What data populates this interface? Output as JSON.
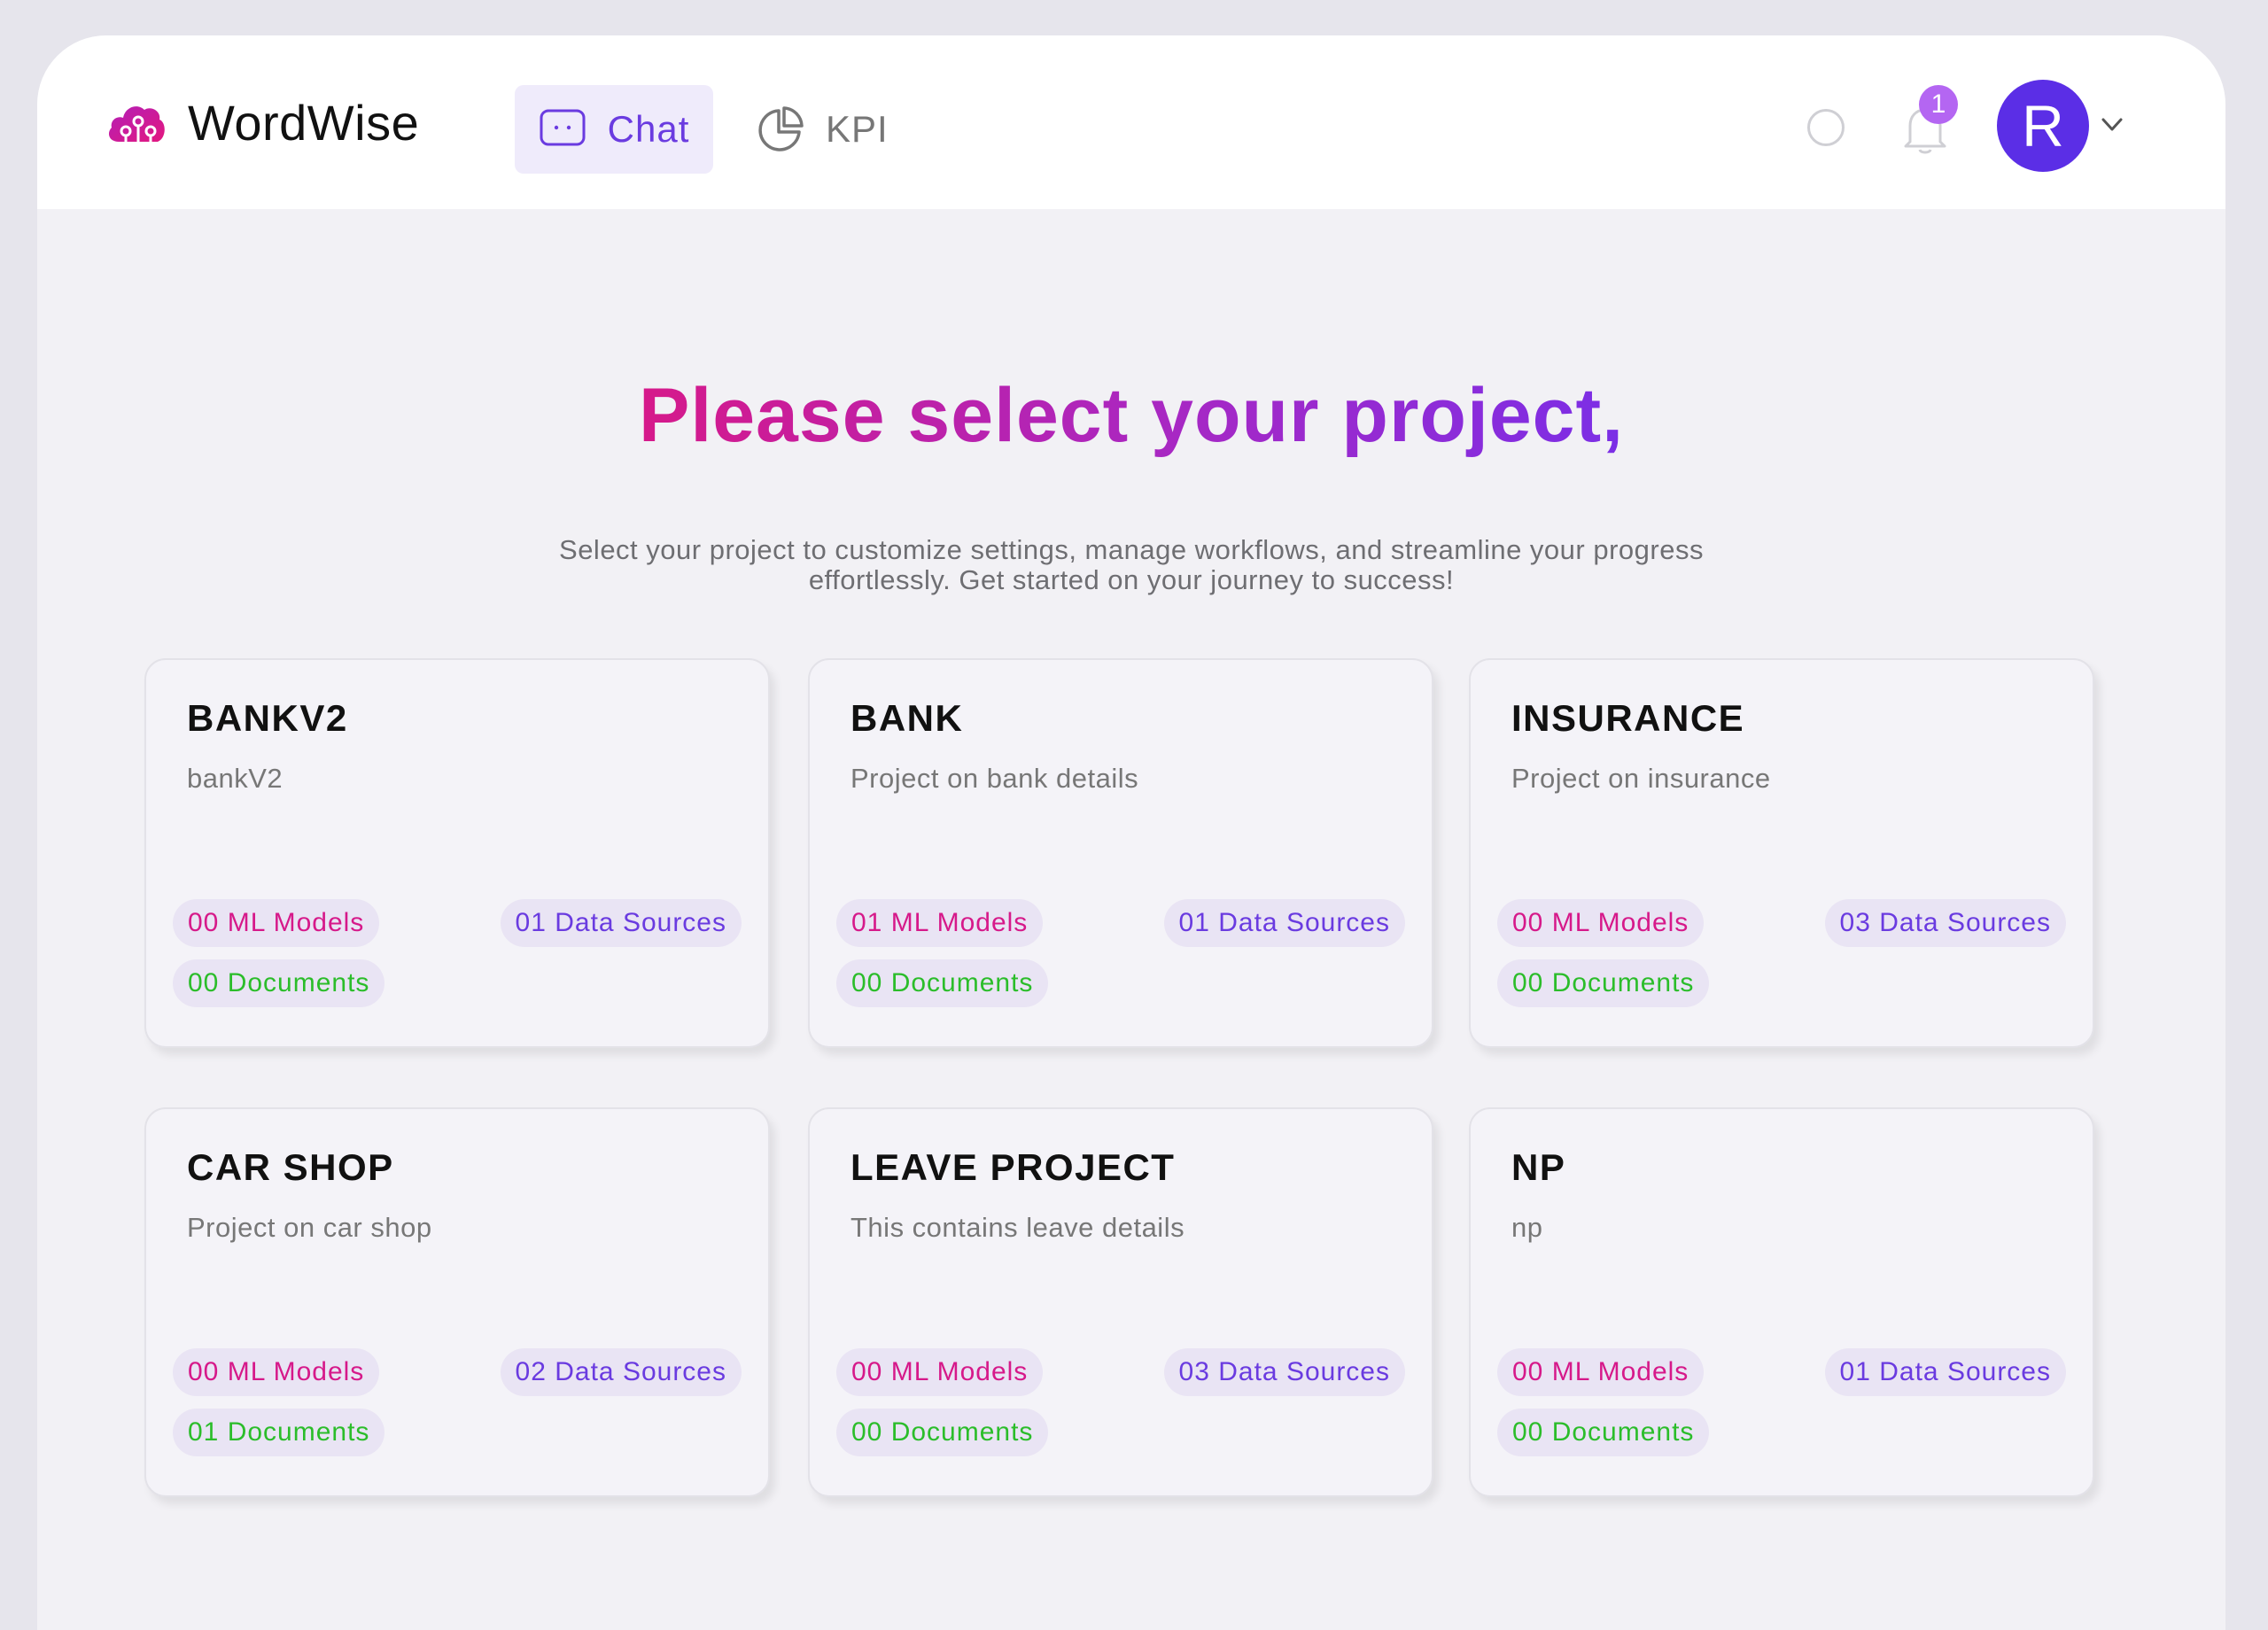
{
  "app": {
    "name": "WordWise"
  },
  "nav": {
    "tabs": [
      {
        "label": "Chat",
        "icon": "chat-bubble-icon",
        "active": true
      },
      {
        "label": "KPI",
        "icon": "pie-chart-icon",
        "active": false
      }
    ]
  },
  "header": {
    "notification_count": "1",
    "avatar_initial": "R"
  },
  "main": {
    "title": "Please select your project,",
    "subtitle_line1": "Select your project to customize settings, manage workflows, and streamline your progress",
    "subtitle_line2": "effortlessly. Get started on your journey to success!"
  },
  "projects": [
    {
      "name": "BANKV2",
      "description": "bankV2",
      "ml_models": "00 ML Models",
      "data_sources": "01 Data Sources",
      "documents": "00 Documents"
    },
    {
      "name": "BANK",
      "description": "Project on bank details",
      "ml_models": "01 ML Models",
      "data_sources": "01 Data Sources",
      "documents": "00 Documents"
    },
    {
      "name": "INSURANCE",
      "description": "Project on insurance",
      "ml_models": "00 ML Models",
      "data_sources": "03 Data Sources",
      "documents": "00 Documents"
    },
    {
      "name": "CAR SHOP",
      "description": "Project on car shop",
      "ml_models": "00 ML Models",
      "data_sources": "02 Data Sources",
      "documents": "01 Documents"
    },
    {
      "name": "LEAVE PROJECT",
      "description": "This contains leave details",
      "ml_models": "00 ML Models",
      "data_sources": "03 Data Sources",
      "documents": "00 Documents"
    },
    {
      "name": "NP",
      "description": "np",
      "ml_models": "00 ML Models",
      "data_sources": "01 Data Sources",
      "documents": "00 Documents"
    }
  ],
  "colors": {
    "brand_purple": "#5b2ee6",
    "accent_pink": "#d6198a",
    "accent_violet": "#6a3be0",
    "accent_green": "#2bbd2a",
    "badge_purple": "#b466f2"
  }
}
